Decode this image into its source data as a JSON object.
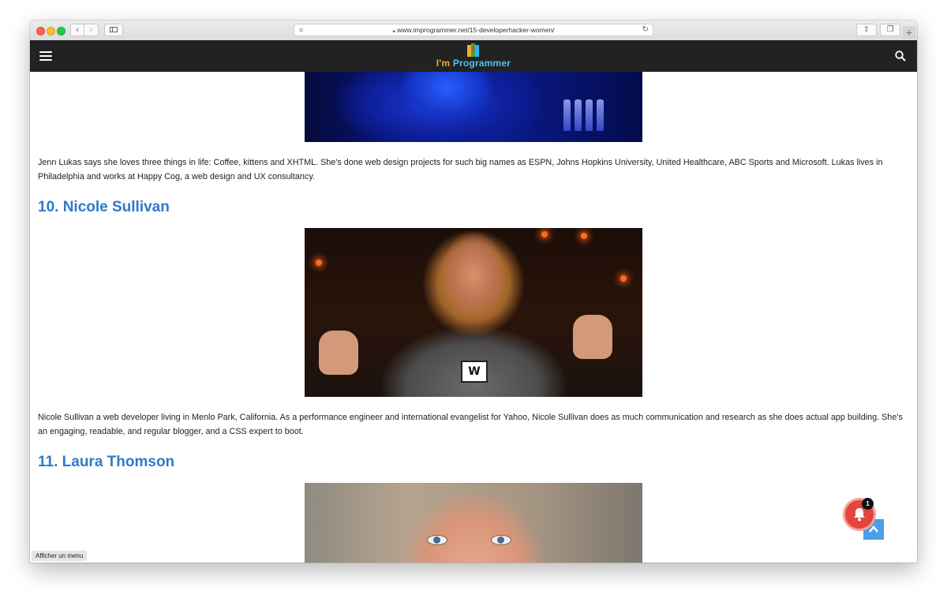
{
  "browser": {
    "url": "www.improgrammer.net/15-developerhacker-women/",
    "back_icon": "chevron-left-icon",
    "forward_icon": "chevron-right-icon"
  },
  "site": {
    "logo_prefix": "I'm",
    "logo_name": "Programmer",
    "accent": "#2f7ac8",
    "header_bg": "#222222"
  },
  "articles": [
    {
      "heading": "",
      "text": "Jenn Lukas says she loves three things in life: Coffee, kittens and XHTML. She's done web design projects for such big names as ESPN, Johns Hopkins University, United Healthcare, ABC Sports and Microsoft. Lukas lives in Philadelphia and works at Happy Cog, a web design and UX consultancy."
    },
    {
      "heading": "10. Nicole Sullivan",
      "text": "Nicole Sullivan a web developer living in Menlo Park, California. As a performance engineer and international evangelist for Yahoo, Nicole Sullivan does as much communication and research as she does actual app building. She's an engaging, readable, and regular blogger, and a CSS expert to boot."
    },
    {
      "heading": "11. Laura Thomson",
      "text": ""
    }
  ],
  "pendant_text": "W",
  "status": {
    "menu_tooltip": "Afficher un menu",
    "notification_count": "1"
  }
}
